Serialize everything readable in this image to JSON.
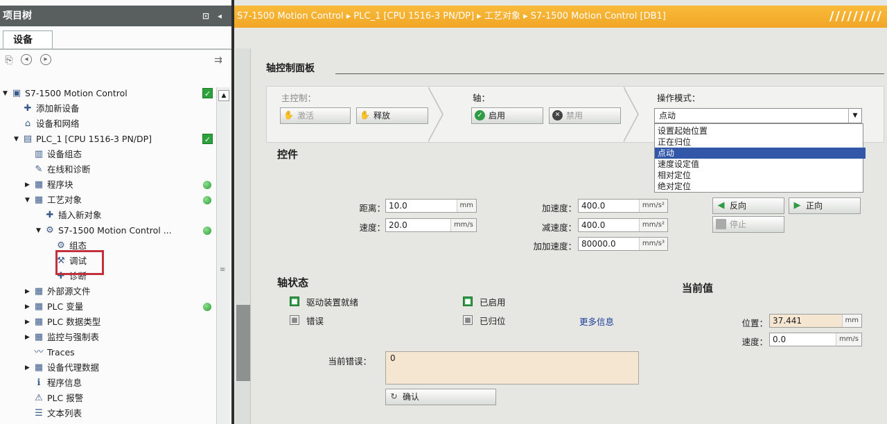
{
  "project_tree": {
    "title": "项目树",
    "tab": "设备",
    "items": [
      {
        "label": "S7-1500 Motion Control",
        "level": 0,
        "expanded": true,
        "icon": "project-icon",
        "status": "ok"
      },
      {
        "label": "添加新设备",
        "level": 1,
        "icon": "add-device-icon"
      },
      {
        "label": "设备和网络",
        "level": 1,
        "icon": "network-icon"
      },
      {
        "label": "PLC_1 [CPU 1516-3 PN/DP]",
        "level": 1,
        "expanded": true,
        "icon": "plc-icon",
        "status": "ok"
      },
      {
        "label": "设备组态",
        "level": 2,
        "icon": "config-icon"
      },
      {
        "label": "在线和诊断",
        "level": 2,
        "icon": "diagnostic-icon"
      },
      {
        "label": "程序块",
        "level": 2,
        "collapsed": true,
        "icon": "folder-icon",
        "status": "dot"
      },
      {
        "label": "工艺对象",
        "level": 2,
        "expanded": true,
        "icon": "folder-icon",
        "status": "dot"
      },
      {
        "label": "插入新对象",
        "level": 3,
        "icon": "insert-icon"
      },
      {
        "label": "S7-1500 Motion Control ...",
        "level": 3,
        "expanded": true,
        "icon": "axis-icon",
        "status": "dot"
      },
      {
        "label": "组态",
        "level": 4,
        "icon": "gear-icon"
      },
      {
        "label": "调试",
        "level": 4,
        "icon": "commissioning-icon"
      },
      {
        "label": "诊断",
        "level": 4,
        "icon": "diagnose-icon"
      },
      {
        "label": "外部源文件",
        "level": 2,
        "collapsed": true,
        "icon": "folder-icon"
      },
      {
        "label": "PLC 变量",
        "level": 2,
        "collapsed": true,
        "icon": "folder-icon",
        "status": "dot"
      },
      {
        "label": "PLC 数据类型",
        "level": 2,
        "collapsed": true,
        "icon": "folder-icon"
      },
      {
        "label": "监控与强制表",
        "level": 2,
        "collapsed": true,
        "icon": "folder-icon"
      },
      {
        "label": "Traces",
        "level": 2,
        "icon": "trace-icon"
      },
      {
        "label": "设备代理数据",
        "level": 2,
        "collapsed": true,
        "icon": "folder-icon"
      },
      {
        "label": "程序信息",
        "level": 2,
        "icon": "info-icon"
      },
      {
        "label": "PLC 报警",
        "level": 2,
        "icon": "alarm-icon"
      },
      {
        "label": "文本列表",
        "level": 2,
        "icon": "text-list-icon"
      }
    ]
  },
  "breadcrumb": "S7-1500 Motion Control  ▸  PLC_1 [CPU 1516-3 PN/DP]  ▸  工艺对象  ▸  S7-1500 Motion Control [DB1]",
  "panel": {
    "title": "轴控制面板",
    "master_control": {
      "label": "主控制：",
      "activate": "激活",
      "deactivate": "释放"
    },
    "axis": {
      "label": "轴：",
      "enable": "启用",
      "disable": "禁用"
    },
    "mode": {
      "label": "操作模式：",
      "value": "点动",
      "options": [
        "设置起始位置",
        "正在归位",
        "点动",
        "速度设定值",
        "相对定位",
        "绝对定位"
      ],
      "selected_index": 2
    }
  },
  "controls": {
    "title": "控件",
    "distance": {
      "label": "距离：",
      "value": "10.0",
      "unit": "mm"
    },
    "speed": {
      "label": "速度：",
      "value": "20.0",
      "unit": "mm/s"
    },
    "accel": {
      "label": "加速度：",
      "value": "400.0",
      "unit": "mm/s²"
    },
    "decel": {
      "label": "减速度：",
      "value": "400.0",
      "unit": "mm/s²"
    },
    "jerk": {
      "label": "加加速度：",
      "value": "80000.0",
      "unit": "mm/s³"
    },
    "backward": "反向",
    "forward": "正向",
    "stop": "停止"
  },
  "axis_status": {
    "title": "轴状态",
    "drive_ready": "驱动装置就绪",
    "enabled": "已启用",
    "error": "错误",
    "homed": "已归位",
    "more_info": "更多信息",
    "pending_error_label": "当前错误：",
    "pending_error_value": "0",
    "confirm": "确认"
  },
  "current_values": {
    "title": "当前值",
    "position": {
      "label": "位置：",
      "value": "37.441",
      "unit": "mm"
    },
    "velocity": {
      "label": "速度：",
      "value": "0.0",
      "unit": "mm/s"
    }
  },
  "colors": {
    "breadcrumb": "#f4ab2c",
    "tree_title": "#585f5e",
    "selection": "#3256a8",
    "highlight_box": "#c2303c"
  }
}
